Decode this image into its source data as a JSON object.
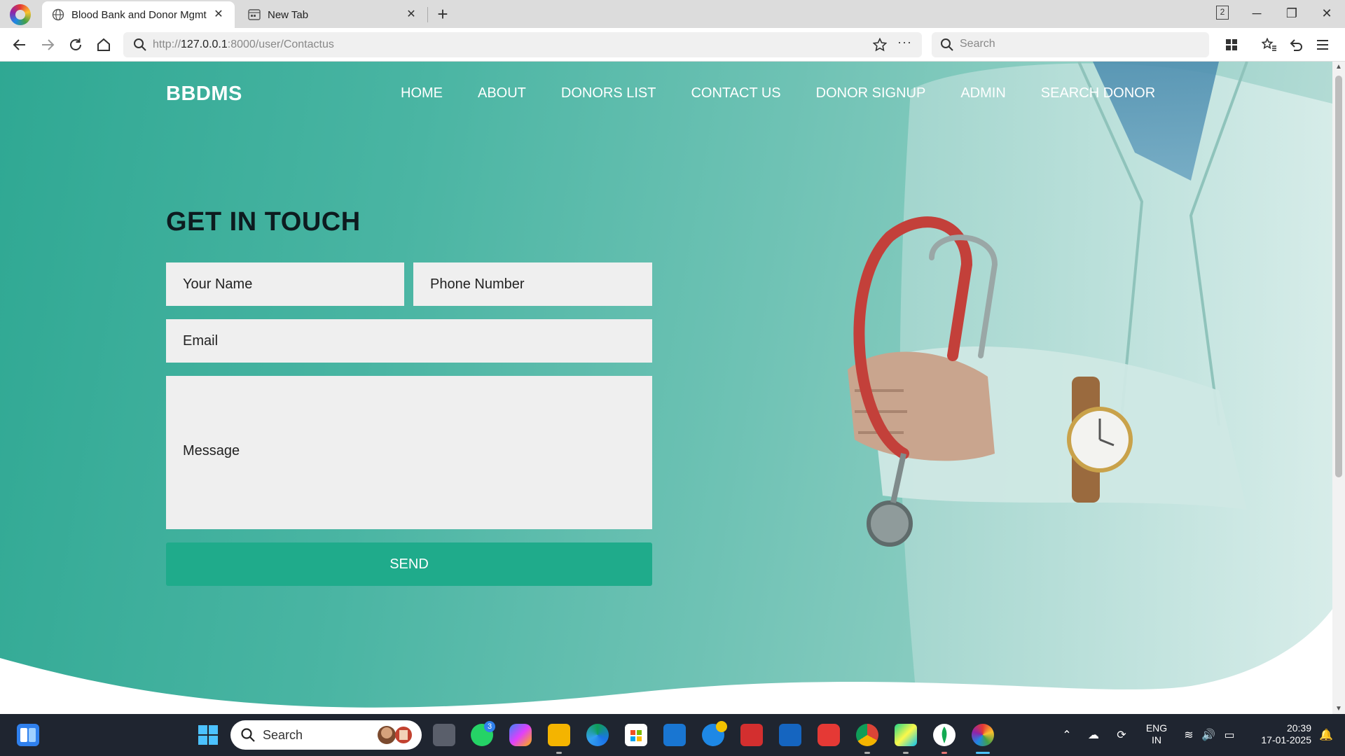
{
  "browser": {
    "tabs": [
      {
        "title": "Blood Bank and Donor Mgmt",
        "active": true
      },
      {
        "title": "New Tab",
        "active": false
      }
    ],
    "tab_count": "2",
    "url": {
      "prefix": "http://",
      "host": "127.0.0.1",
      "rest": ":8000/user/Contactus"
    },
    "search_placeholder": "Search"
  },
  "site": {
    "brand": "BBDMS",
    "nav": [
      "HOME",
      "ABOUT",
      "DONORS LIST",
      "CONTACT US",
      "DONOR SIGNUP",
      "ADMIN",
      "SEARCH DONOR"
    ]
  },
  "contact_form": {
    "heading": "GET IN TOUCH",
    "name_placeholder": "Your Name",
    "phone_placeholder": "Phone Number",
    "email_placeholder": "Email",
    "message_placeholder": "Message",
    "send_label": "SEND",
    "accent": "#1fab8b"
  },
  "taskbar": {
    "search_label": "Search",
    "whatsapp_badge": "3",
    "language": "ENG",
    "region": "IN",
    "time": "20:39",
    "date": "17-01-2025"
  },
  "colors": {
    "hero_start": "#2fa893",
    "hero_end": "#bfe0da",
    "taskbar_bg": "#1f2530"
  }
}
